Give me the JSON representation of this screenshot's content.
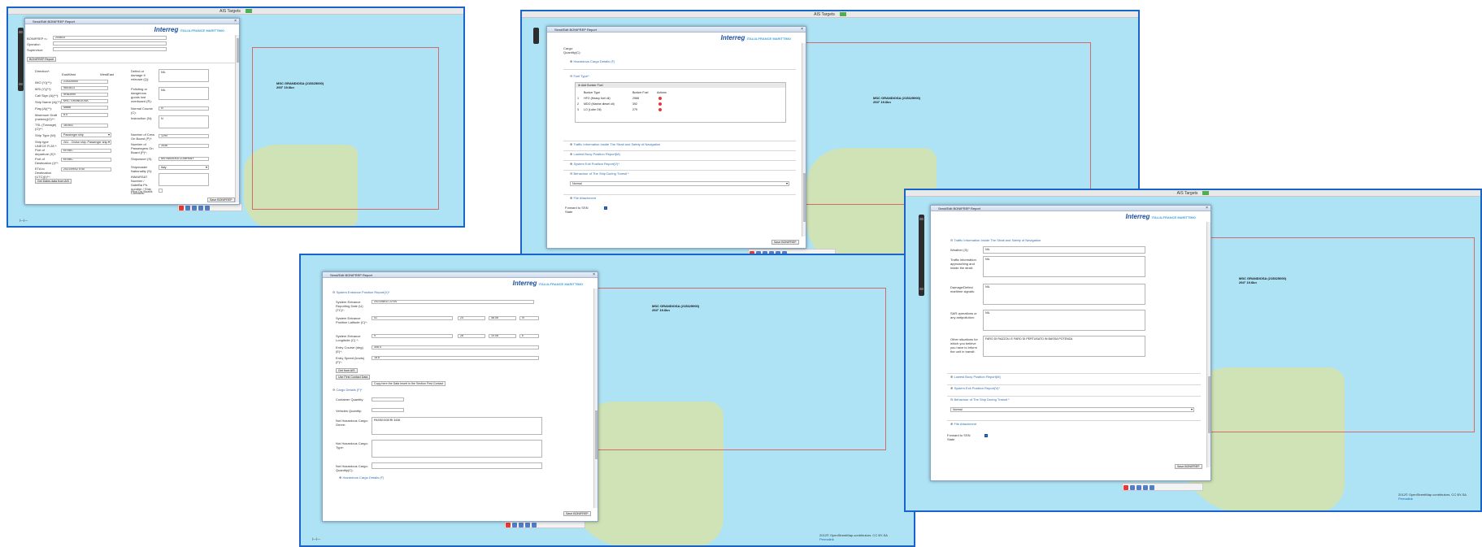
{
  "map_title": "AIS Targets",
  "ship_name": "MSC GRANDIOSA (215325000)",
  "ship_speed": "293° 19.6kn",
  "ship_speed_b": "294° 19.6kn",
  "attribution": "2012© OpenStreetMap contributors. CC BY-SA",
  "permalink": "Permalink",
  "dialog_title": "Send/Edit BONIFREP Report",
  "logo": "Interreg",
  "logo_sub": "ITALIA-FRANCE MARITTIMO",
  "save_btn": "Save BONIFREP",
  "w1": {
    "bonifrep": "BONIFREP n.:",
    "bonifrep_val": "204633",
    "operator": "Operator:",
    "supervisor": "Supervisor:",
    "tab": "BONIFREP Report",
    "direction": "Direction*:",
    "eastwest": "EastWest",
    "westeast": "WestEast",
    "imo": "IMO (Y)(**):",
    "imo_val": "215325000",
    "mmsi": "MSI (Y)(**):",
    "mmsi_val": "9803613",
    "callsign": "Call Sign (A)(**):",
    "callsign_val": "9HA3999",
    "shipname": "Ship Name (A)(**):",
    "shipname_val": "MSC GRANDIOSA",
    "flag": "Flag (A)(**):",
    "flag_val": "Malta",
    "draft": "Maximum Draft (metres)(O)**:",
    "draft_val": "8.5",
    "tsl": "TSL (Tonnage)(O)**:",
    "tsl_val": "181541",
    "shiptype": "Ship Type (W):",
    "shiptype_val": "Passenger ship",
    "shiptype2": "Ship type UNECE R.28 *:",
    "shiptype2_val": "2A1 - Cruise ship: Passenger ship",
    "port_dep": "Port of departure (K)*:",
    "port_dep_val": "EEVAC",
    "port_dest": "Port of Destination (I)**:",
    "port_dest_val": "EEVAC",
    "eta": "ETA to Destination (UTC)(I)**:",
    "eta_val": "2021/09/02 5:40",
    "getdates": "Get Dates data from AIS",
    "defect": "Defect or damage if relevant (Q):",
    "defect_val": "NIL",
    "polluting": "Polluting or dangerous goods lost overboard (R):",
    "polluting_val": "NIL",
    "course": "Normal Course (C):",
    "course_val": "N",
    "instruction": "Instruction (N):",
    "instruction_val": "N",
    "crew": "Number of Crew On Board (P)*:",
    "crew_val": "1290",
    "pax": "Number of Passengers On Board (P)*:",
    "pax_val": "3436",
    "shipowner": "Shipowner (S):",
    "shipowner_val": "MS NAVIERA COMPANY",
    "nationality": "Shipmaster Nationality (S):",
    "nationality_val": "Italy",
    "inmarsat": "INMARSAT Number / SatelBa Ph. number / Ship Contacts:",
    "pilot": "Pilot On Board:"
  },
  "w2": {
    "cargo_qty": "Cargo: Quantity(C):",
    "haz": "Hazardous Cargo Details (F)",
    "fuel": "Fuel Type*",
    "add_fuel": "Add Bunker Fuel",
    "col_type": "Bunker Type",
    "col_qty": "Bunker Fuel",
    "col_act": "Actions",
    "fuel_rows": [
      {
        "n": "1",
        "t": "HFO (Heavy fuel oil)",
        "q": "2968"
      },
      {
        "n": "2",
        "t": "MDO (Marine diesel oil)",
        "q": "392"
      },
      {
        "n": "3",
        "t": "LO (Lube Oil)",
        "q": "279"
      }
    ],
    "traffic": "Traffic Information Inside The Strait and Safety of Navigation",
    "lowest": "Lowest Buoy Position Report(M)",
    "exit": "System Exit Position Report(V)*",
    "behaviour": "Behaviour of The Ship During Transit *",
    "normal": "Normal",
    "attach": "File Attachment",
    "forward": "Forward to SSN State"
  },
  "w3": {
    "sys_entry": "System Entrance Position Report(X)*",
    "rep_date": "System Entrance Reporting Date (U)(TC)*:",
    "rep_date_val": "2021/08/31 22:04",
    "lat": "System Entrance Position Latitude (C)*:",
    "lat_d": "41",
    "lat_m": "24",
    "lat_s": "48.06",
    "lat_h": "N",
    "lon": "System Entrance Longitude (C) *:",
    "lon_d": "9",
    "lon_m": "28",
    "lon_s": "10.08",
    "lon_h": "E",
    "ecourse": "Entry Course (deg) (E)*:",
    "ecourse_val": "306.4",
    "espeed": "Entry Speed (knots) (F)*:",
    "espeed_val": "18.6",
    "getais": "Get from AIS",
    "firstcontact": "Use First Contact Data",
    "tooltip": "Copy here the Data Insert in the Section First Contact",
    "cargo": "Cargo Details (F)*",
    "container": "Container Quantity:",
    "vehicles": "Vehicles Quantity:",
    "nhaz_gen": "Not Hazardous Cargo: Genre:",
    "nhaz_gen_val": "PASSEGGERI 3436",
    "nhaz_type": "Not Hazardous Cargo: Type:",
    "nhaz_qty": "Not Hazardous Cargo: Quantity(C):",
    "haz": "Hazardous Cargo Details (F)"
  },
  "w4": {
    "traffic": "Traffic Information Inside The Strait and Safety of Navigation",
    "weather": "Weather (S):",
    "weather_val": "NIL",
    "traf_info": "Traffic information approaching and inside the strait:",
    "traf_info_val": "NIL",
    "damage": "Damage/Defect maritime signals:",
    "damage_val": "NIL",
    "sar": "SAR operations or any antipollution:",
    "sar_val": "NIL",
    "other": "Other situations for which you believe you have to inform the unit in transit:",
    "other_val": "FARO DI RAZZOLI E FARO DI PERTUSATO IN BASSA POTENZA",
    "lowest": "Lowest Buoy Position Report(M)",
    "exit": "System Exit Position Report(V)*",
    "behaviour": "Behaviour of The Ship During Transit *",
    "normal": "Normal",
    "attach": "File Attachment",
    "forward": "Forward to SSN State"
  },
  "colors": {
    "border": "#1a63c9",
    "sea": "#aee3f5",
    "land": "#cfe3b6",
    "accent": "#2f6fb5"
  }
}
